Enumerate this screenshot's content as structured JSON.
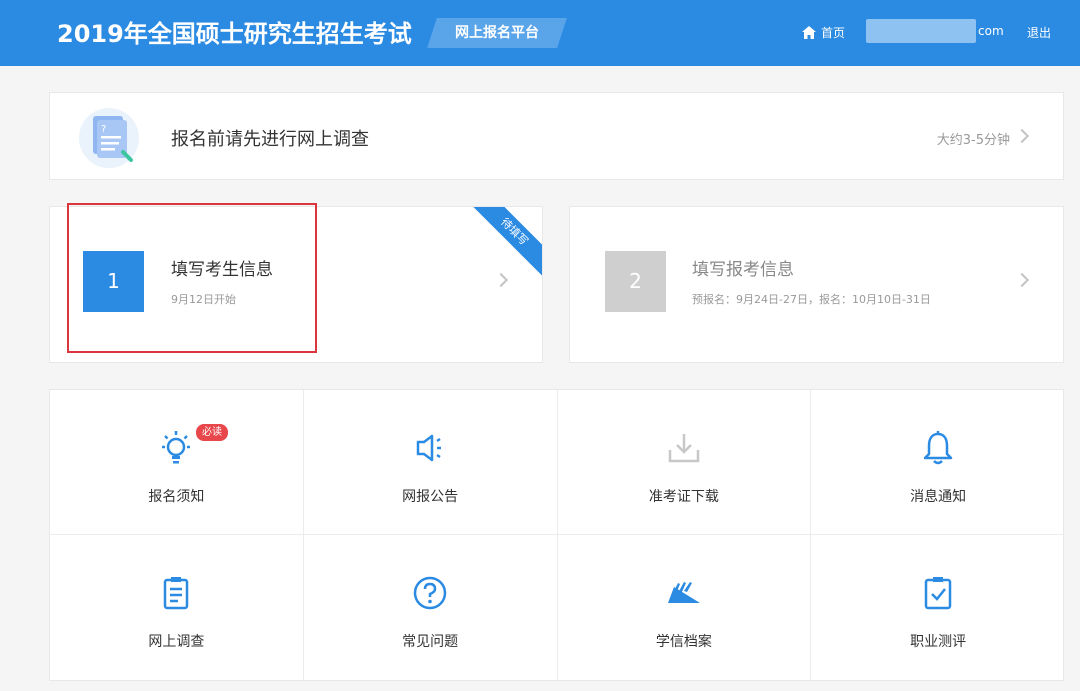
{
  "header": {
    "title": "2019年全国硕士研究生招生考试",
    "platform": "网上报名平台",
    "home": "首页",
    "user_suffix": "com",
    "logout": "退出"
  },
  "survey": {
    "text": "报名前请先进行网上调查",
    "time": "大约3-5分钟",
    "icon": "survey-document-icon"
  },
  "steps": [
    {
      "number": "1",
      "title": "填写考生信息",
      "subtitle": "9月12日开始",
      "ribbon": "待填写",
      "status_color": "#2b8ae2"
    },
    {
      "number": "2",
      "title": "填写报考信息",
      "subtitle": "预报名：9月24日-27日，报名：10月10日-31日",
      "status_color": "#cfcfcf"
    }
  ],
  "grid": {
    "items": [
      {
        "label": "报名须知",
        "icon": "lightbulb-icon",
        "badge": "必读"
      },
      {
        "label": "网报公告",
        "icon": "speaker-icon"
      },
      {
        "label": "准考证下载",
        "icon": "download-icon"
      },
      {
        "label": "消息通知",
        "icon": "bell-icon"
      },
      {
        "label": "网上调查",
        "icon": "clipboard-icon"
      },
      {
        "label": "常见问题",
        "icon": "question-icon"
      },
      {
        "label": "学信档案",
        "icon": "archive-icon"
      },
      {
        "label": "职业测评",
        "icon": "check-clipboard-icon"
      }
    ]
  },
  "colors": {
    "primary": "#2b8ae2",
    "highlight": "#d9363e",
    "badge": "#e8484c"
  }
}
